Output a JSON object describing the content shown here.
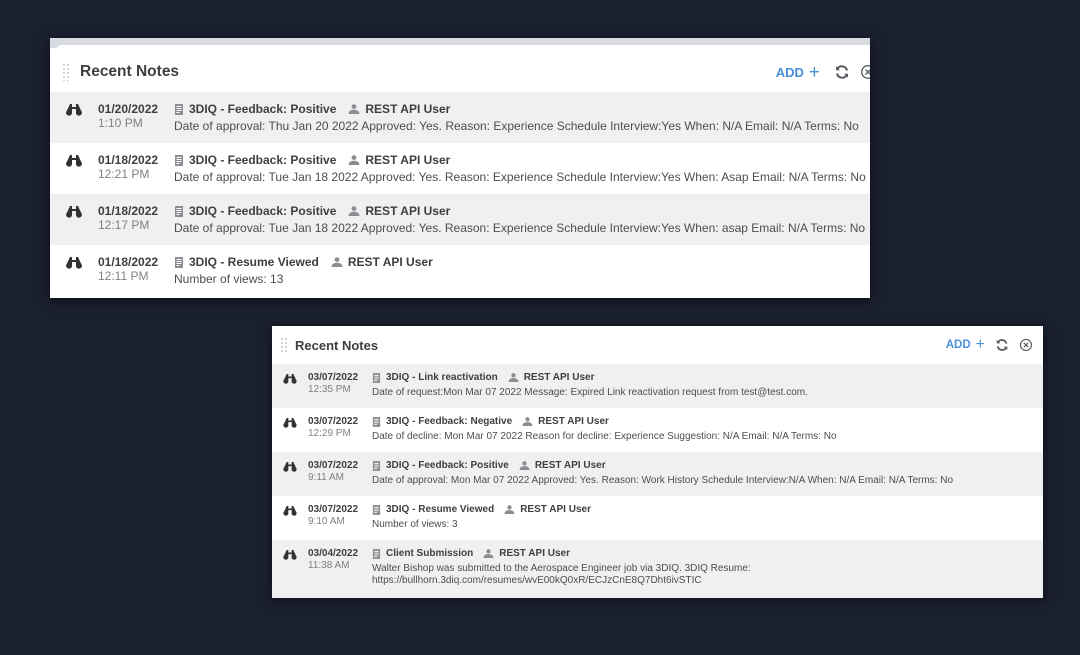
{
  "panel1": {
    "title": "Recent Notes",
    "add_label": "ADD",
    "add_icon": "plus-icon",
    "refresh_icon": "refresh-icon",
    "close_icon": "close-circle-icon",
    "notes": [
      {
        "date": "01/20/2022",
        "time": "1:10 PM",
        "type": "3DIQ - Feedback: Positive",
        "user": "REST API User",
        "text": "Date of approval: Thu Jan 20 2022 Approved: Yes. Reason: Experience Schedule Interview:Yes When: N/A Email: N/A Terms: No"
      },
      {
        "date": "01/18/2022",
        "time": "12:21 PM",
        "type": "3DIQ - Feedback: Positive",
        "user": "REST API User",
        "text": "Date of approval: Tue Jan 18 2022 Approved: Yes. Reason: Experience Schedule Interview:Yes When: Asap Email: N/A Terms: No"
      },
      {
        "date": "01/18/2022",
        "time": "12:17 PM",
        "type": "3DIQ - Feedback: Positive",
        "user": "REST API User",
        "text": "Date of approval: Tue Jan 18 2022 Approved: Yes. Reason: Experience Schedule Interview:Yes When: asap Email: N/A Terms: No"
      },
      {
        "date": "01/18/2022",
        "time": "12:11 PM",
        "type": "3DIQ - Resume Viewed",
        "user": "REST API User",
        "text": "Number of views: 13"
      }
    ]
  },
  "panel2": {
    "title": "Recent Notes",
    "add_label": "ADD",
    "add_icon": "plus-icon",
    "refresh_icon": "refresh-icon",
    "close_icon": "close-circle-icon",
    "notes": [
      {
        "date": "03/07/2022",
        "time": "12:35 PM",
        "type": "3DIQ - Link reactivation",
        "user": "REST API User",
        "text": "Date of request:Mon Mar 07 2022 Message: Expired Link reactivation request from test@test.com."
      },
      {
        "date": "03/07/2022",
        "time": "12:29 PM",
        "type": "3DIQ - Feedback: Negative",
        "user": "REST API User",
        "text": "Date of decline: Mon Mar 07 2022 Reason for decline: Experience Suggestion: N/A Email: N/A Terms: No"
      },
      {
        "date": "03/07/2022",
        "time": "9:11 AM",
        "type": "3DIQ - Feedback: Positive",
        "user": "REST API User",
        "text": "Date of approval: Mon Mar 07 2022 Approved: Yes. Reason: Work History Schedule Interview:N/A When: N/A Email: N/A Terms: No"
      },
      {
        "date": "03/07/2022",
        "time": "9:10 AM",
        "type": "3DIQ - Resume Viewed",
        "user": "REST API User",
        "text": "Number of views: 3"
      },
      {
        "date": "03/04/2022",
        "time": "11:38 AM",
        "type": "Client Submission",
        "user": "REST API User",
        "text": "Walter Bishop was submitted to the Aerospace Engineer job via 3DIQ. 3DIQ Resume:\nhttps://bullhorn.3diq.com/resumes/wvE00kQ0xR/ECJzCnE8Q7Dht6ivSTIC"
      }
    ]
  }
}
